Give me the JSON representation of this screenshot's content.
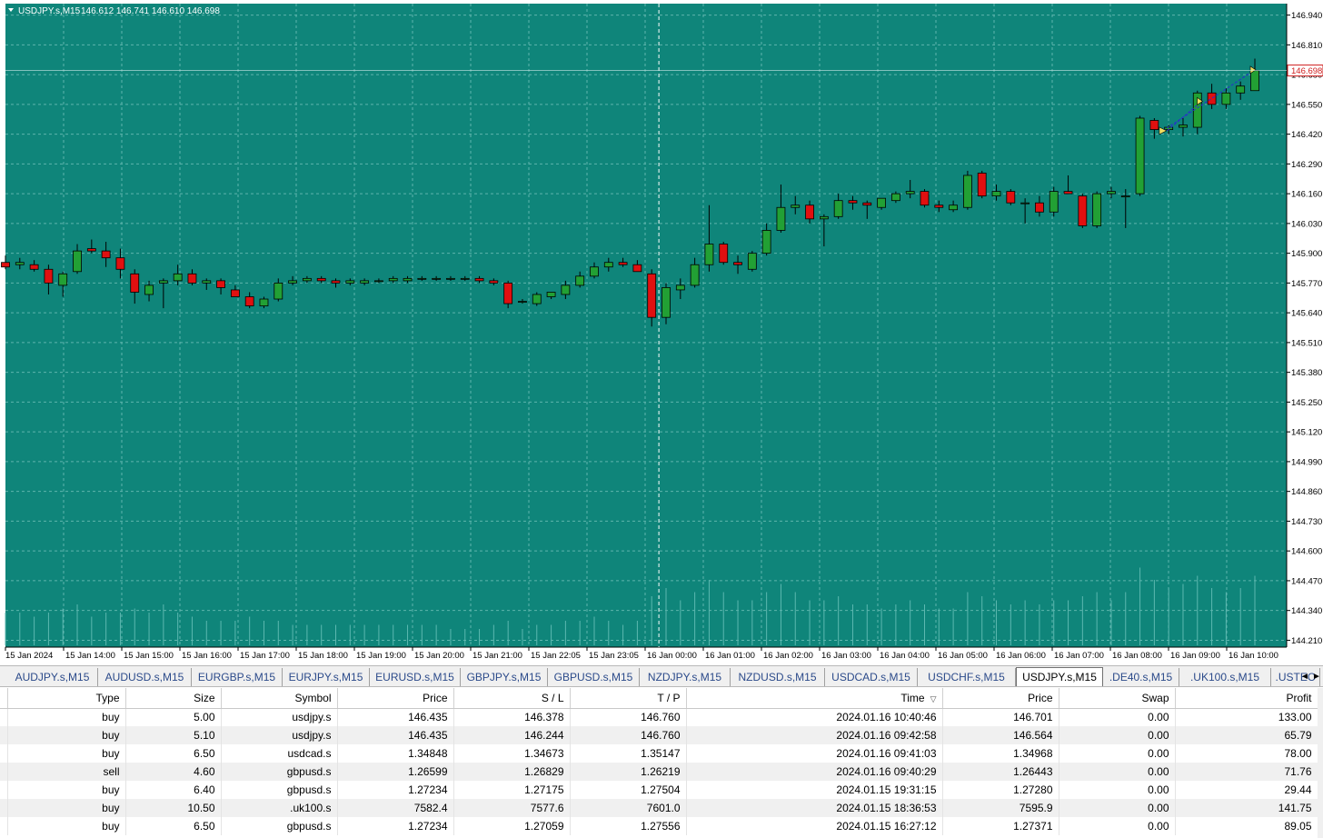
{
  "chart": {
    "header_symbol": "USDJPY.s,M15",
    "header_ohlc": "146.612 146.741 146.610 146.698",
    "current_price": "146.698",
    "colors": {
      "background": "#0f857a",
      "grid": "#5fb5ad",
      "bull": "#22a034",
      "bear": "#e01010",
      "candle_outline": "#000000",
      "axis_bg": "#ffffff",
      "axis_text": "#000000",
      "volume": "#5cb8b0",
      "crosshair": "#ffffff",
      "trade_line": "#2b2bd0",
      "marker": "#f0e060"
    },
    "y_ticks": [
      "146.940",
      "146.810",
      "146.680",
      "146.550",
      "146.420",
      "146.290",
      "146.160",
      "146.030",
      "145.900",
      "145.770",
      "145.640",
      "145.510",
      "145.380",
      "145.250",
      "145.120",
      "144.990",
      "144.860",
      "144.730",
      "144.600",
      "144.470",
      "144.340",
      "144.210"
    ],
    "x_ticks": [
      "15 Jan 2024",
      "15 Jan 14:00",
      "15 Jan 15:00",
      "15 Jan 16:00",
      "15 Jan 17:00",
      "15 Jan 18:00",
      "15 Jan 19:00",
      "15 Jan 20:00",
      "15 Jan 21:00",
      "15 Jan 22:05",
      "15 Jan 23:05",
      "16 Jan 00:00",
      "16 Jan 01:00",
      "16 Jan 02:00",
      "16 Jan 03:00",
      "16 Jan 04:00",
      "16 Jan 05:00",
      "16 Jan 06:00",
      "16 Jan 07:00",
      "16 Jan 08:00",
      "16 Jan 09:00",
      "16 Jan 10:00"
    ]
  },
  "chart_data": {
    "type": "candlestick",
    "symbol": "USDJPY.s",
    "timeframe": "M15",
    "ylim": [
      144.18,
      146.99
    ],
    "last": 146.698,
    "candles": [
      [
        145.86,
        145.89,
        145.83,
        145.84
      ],
      [
        145.85,
        145.88,
        145.83,
        145.86
      ],
      [
        145.85,
        145.87,
        145.82,
        145.83
      ],
      [
        145.83,
        145.85,
        145.72,
        145.77
      ],
      [
        145.76,
        145.82,
        145.71,
        145.81
      ],
      [
        145.82,
        145.94,
        145.81,
        145.91
      ],
      [
        145.92,
        145.96,
        145.9,
        145.91
      ],
      [
        145.91,
        145.95,
        145.84,
        145.88
      ],
      [
        145.88,
        145.92,
        145.79,
        145.83
      ],
      [
        145.81,
        145.83,
        145.68,
        145.73
      ],
      [
        145.72,
        145.78,
        145.69,
        145.76
      ],
      [
        145.77,
        145.79,
        145.66,
        145.78
      ],
      [
        145.78,
        145.85,
        145.76,
        145.81
      ],
      [
        145.81,
        145.83,
        145.76,
        145.77
      ],
      [
        145.77,
        145.79,
        145.74,
        145.78
      ],
      [
        145.78,
        145.79,
        145.72,
        145.75
      ],
      [
        145.74,
        145.76,
        145.71,
        145.71
      ],
      [
        145.71,
        145.73,
        145.66,
        145.67
      ],
      [
        145.67,
        145.71,
        145.66,
        145.7
      ],
      [
        145.7,
        145.79,
        145.69,
        145.77
      ],
      [
        145.77,
        145.8,
        145.76,
        145.78
      ],
      [
        145.78,
        145.8,
        145.77,
        145.79
      ],
      [
        145.79,
        145.8,
        145.77,
        145.78
      ],
      [
        145.78,
        145.79,
        145.75,
        145.77
      ],
      [
        145.77,
        145.79,
        145.76,
        145.78
      ],
      [
        145.77,
        145.79,
        145.76,
        145.78
      ],
      [
        145.78,
        145.79,
        145.77,
        145.78
      ],
      [
        145.78,
        145.8,
        145.77,
        145.79
      ],
      [
        145.78,
        145.8,
        145.77,
        145.79
      ],
      [
        145.79,
        145.8,
        145.78,
        145.79
      ],
      [
        145.79,
        145.8,
        145.78,
        145.79
      ],
      [
        145.79,
        145.8,
        145.78,
        145.79
      ],
      [
        145.79,
        145.8,
        145.78,
        145.79
      ],
      [
        145.79,
        145.8,
        145.77,
        145.78
      ],
      [
        145.78,
        145.79,
        145.76,
        145.77
      ],
      [
        145.77,
        145.78,
        145.66,
        145.68
      ],
      [
        145.69,
        145.7,
        145.68,
        145.69
      ],
      [
        145.68,
        145.73,
        145.67,
        145.72
      ],
      [
        145.71,
        145.73,
        145.7,
        145.73
      ],
      [
        145.72,
        145.78,
        145.7,
        145.76
      ],
      [
        145.76,
        145.82,
        145.75,
        145.8
      ],
      [
        145.8,
        145.86,
        145.79,
        145.84
      ],
      [
        145.84,
        145.88,
        145.82,
        145.86
      ],
      [
        145.86,
        145.88,
        145.84,
        145.85
      ],
      [
        145.85,
        145.87,
        145.82,
        145.82
      ],
      [
        145.81,
        145.83,
        145.58,
        145.62
      ],
      [
        145.62,
        145.77,
        145.59,
        145.75
      ],
      [
        145.74,
        145.79,
        145.7,
        145.76
      ],
      [
        145.76,
        145.88,
        145.75,
        145.85
      ],
      [
        145.85,
        146.11,
        145.82,
        145.94
      ],
      [
        145.94,
        145.95,
        145.85,
        145.86
      ],
      [
        145.86,
        145.89,
        145.81,
        145.85
      ],
      [
        145.83,
        145.91,
        145.82,
        145.9
      ],
      [
        145.9,
        146.03,
        145.89,
        146.0
      ],
      [
        146.0,
        146.2,
        145.99,
        146.1
      ],
      [
        146.1,
        146.15,
        146.07,
        146.11
      ],
      [
        146.11,
        146.13,
        146.03,
        146.05
      ],
      [
        146.05,
        146.07,
        145.93,
        146.06
      ],
      [
        146.06,
        146.16,
        146.05,
        146.13
      ],
      [
        146.13,
        146.15,
        146.09,
        146.12
      ],
      [
        146.12,
        146.13,
        146.05,
        146.11
      ],
      [
        146.1,
        146.14,
        146.09,
        146.14
      ],
      [
        146.13,
        146.17,
        146.12,
        146.16
      ],
      [
        146.16,
        146.22,
        146.14,
        146.17
      ],
      [
        146.17,
        146.18,
        146.1,
        146.11
      ],
      [
        146.11,
        146.13,
        146.08,
        146.1
      ],
      [
        146.09,
        146.13,
        146.08,
        146.11
      ],
      [
        146.1,
        146.26,
        146.09,
        146.24
      ],
      [
        146.25,
        146.26,
        146.14,
        146.15
      ],
      [
        146.15,
        146.2,
        146.13,
        146.17
      ],
      [
        146.17,
        146.18,
        146.11,
        146.12
      ],
      [
        146.12,
        146.14,
        146.03,
        146.12
      ],
      [
        146.12,
        146.15,
        146.06,
        146.08
      ],
      [
        146.08,
        146.19,
        146.06,
        146.17
      ],
      [
        146.17,
        146.24,
        146.16,
        146.16
      ],
      [
        146.15,
        146.16,
        146.01,
        146.02
      ],
      [
        146.02,
        146.17,
        146.01,
        146.16
      ],
      [
        146.16,
        146.19,
        146.14,
        146.17
      ],
      [
        146.15,
        146.18,
        146.01,
        146.15
      ],
      [
        146.16,
        146.5,
        146.15,
        146.49
      ],
      [
        146.48,
        146.49,
        146.4,
        146.44
      ],
      [
        146.44,
        146.46,
        146.42,
        146.45
      ],
      [
        146.45,
        146.49,
        146.41,
        146.46
      ],
      [
        146.45,
        146.61,
        146.42,
        146.6
      ],
      [
        146.6,
        146.64,
        146.53,
        146.55
      ],
      [
        146.55,
        146.62,
        146.53,
        146.6
      ],
      [
        146.6,
        146.65,
        146.57,
        146.63
      ],
      [
        146.61,
        146.75,
        146.61,
        146.698
      ]
    ],
    "volumes": [
      0.4,
      0.4,
      0.35,
      0.4,
      0.45,
      0.5,
      0.35,
      0.4,
      0.4,
      0.45,
      0.4,
      0.5,
      0.4,
      0.35,
      0.3,
      0.3,
      0.3,
      0.35,
      0.3,
      0.3,
      0.25,
      0.25,
      0.25,
      0.25,
      0.25,
      0.25,
      0.25,
      0.25,
      0.25,
      0.25,
      0.25,
      0.2,
      0.2,
      0.2,
      0.25,
      0.3,
      0.2,
      0.25,
      0.25,
      0.3,
      0.3,
      0.35,
      0.3,
      0.25,
      0.3,
      0.6,
      0.7,
      0.55,
      0.65,
      0.8,
      0.65,
      0.55,
      0.55,
      0.65,
      0.75,
      0.65,
      0.55,
      0.55,
      0.6,
      0.5,
      0.5,
      0.45,
      0.5,
      0.55,
      0.5,
      0.45,
      0.45,
      0.65,
      0.6,
      0.55,
      0.5,
      0.55,
      0.5,
      0.55,
      0.55,
      0.6,
      0.65,
      0.55,
      0.65,
      0.95,
      0.8,
      0.7,
      0.75,
      0.85,
      0.7,
      0.65,
      0.7,
      0.85
    ],
    "trades": [
      {
        "type": "buy",
        "open_price": 146.435,
        "open_time": "2024.01.16 10:40:46",
        "current_price": 146.701,
        "sl": 146.378,
        "tp": 146.76
      },
      {
        "type": "buy",
        "open_price": 146.435,
        "open_time": "2024.01.16 09:42:58",
        "current_price": 146.564,
        "sl": 146.244,
        "tp": 146.76
      }
    ]
  },
  "tabs": [
    {
      "label": "AUDJPY.s,M15",
      "active": false
    },
    {
      "label": "AUDUSD.s,M15",
      "active": false
    },
    {
      "label": "EURGBP.s,M15",
      "active": false
    },
    {
      "label": "EURJPY.s,M15",
      "active": false
    },
    {
      "label": "EURUSD.s,M15",
      "active": false
    },
    {
      "label": "GBPJPY.s,M15",
      "active": false
    },
    {
      "label": "GBPUSD.s,M15",
      "active": false
    },
    {
      "label": "NZDJPY.s,M15",
      "active": false
    },
    {
      "label": "NZDUSD.s,M15",
      "active": false
    },
    {
      "label": "USDCAD.s,M15",
      "active": false
    },
    {
      "label": "USDCHF.s,M15",
      "active": false
    },
    {
      "label": "USDJPY.s,M15",
      "active": true
    },
    {
      "label": ".DE40.s,M15",
      "active": false
    },
    {
      "label": ".UK100.s,M15",
      "active": false
    },
    {
      "label": ".USTEC",
      "active": false
    }
  ],
  "trade_table": {
    "columns": [
      "Type",
      "Size",
      "Symbol",
      "Price",
      "S / L",
      "T / P",
      "Time",
      "Price",
      "Swap",
      "Profit"
    ],
    "sort_arrow": "▽",
    "rows": [
      [
        "buy",
        "5.00",
        "usdjpy.s",
        "146.435",
        "146.378",
        "146.760",
        "2024.01.16 10:40:46",
        "146.701",
        "0.00",
        "133.00"
      ],
      [
        "buy",
        "5.10",
        "usdjpy.s",
        "146.435",
        "146.244",
        "146.760",
        "2024.01.16 09:42:58",
        "146.564",
        "0.00",
        "65.79"
      ],
      [
        "buy",
        "6.50",
        "usdcad.s",
        "1.34848",
        "1.34673",
        "1.35147",
        "2024.01.16 09:41:03",
        "1.34968",
        "0.00",
        "78.00"
      ],
      [
        "sell",
        "4.60",
        "gbpusd.s",
        "1.26599",
        "1.26829",
        "1.26219",
        "2024.01.16 09:40:29",
        "1.26443",
        "0.00",
        "71.76"
      ],
      [
        "buy",
        "6.40",
        "gbpusd.s",
        "1.27234",
        "1.27175",
        "1.27504",
        "2024.01.15 19:31:15",
        "1.27280",
        "0.00",
        "29.44"
      ],
      [
        "buy",
        "10.50",
        ".uk100.s",
        "7582.4",
        "7577.6",
        "7601.0",
        "2024.01.15 18:36:53",
        "7595.9",
        "0.00",
        "141.75"
      ],
      [
        "buy",
        "6.50",
        "gbpusd.s",
        "1.27234",
        "1.27059",
        "1.27556",
        "2024.01.15 16:27:12",
        "1.27371",
        "0.00",
        "89.05"
      ]
    ]
  }
}
